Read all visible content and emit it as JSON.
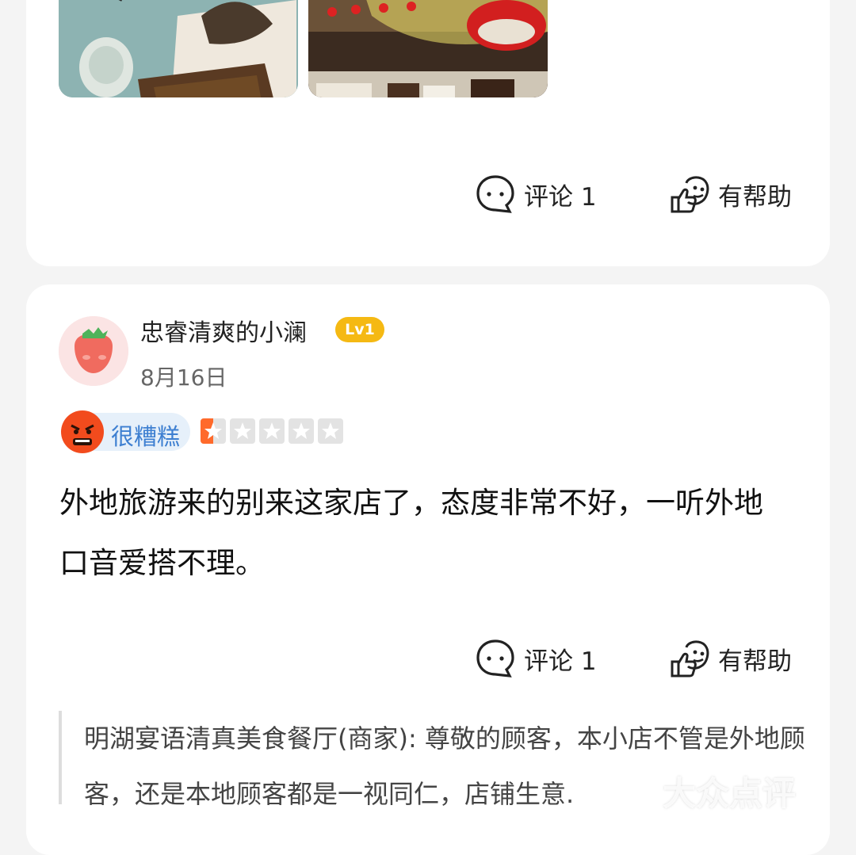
{
  "review1": {
    "actions": {
      "comment_label": "评论 1",
      "helpful_label": "有帮助"
    }
  },
  "review2": {
    "user": {
      "name": "忠睿清爽的小澜",
      "level": "Lv1",
      "date": "8月16日"
    },
    "rating": {
      "label": "很糟糕",
      "stars": 1,
      "max_stars": 5
    },
    "text": "外地旅游来的别来这家店了，态度非常不好，一听外地口音爱搭不理。",
    "actions": {
      "comment_label": "评论 1",
      "helpful_label": "有帮助"
    },
    "merchant_reply": "明湖宴语清真美食餐厅(商家): 尊敬的顾客，本小店不管是外地顾客，还是本地顾客都是一视同仁，店铺生意."
  },
  "watermark": "大众点评",
  "colors": {
    "level_badge": "#f5b913",
    "rating_text": "#3d7fd1",
    "star_active": "#ff6a2b"
  }
}
